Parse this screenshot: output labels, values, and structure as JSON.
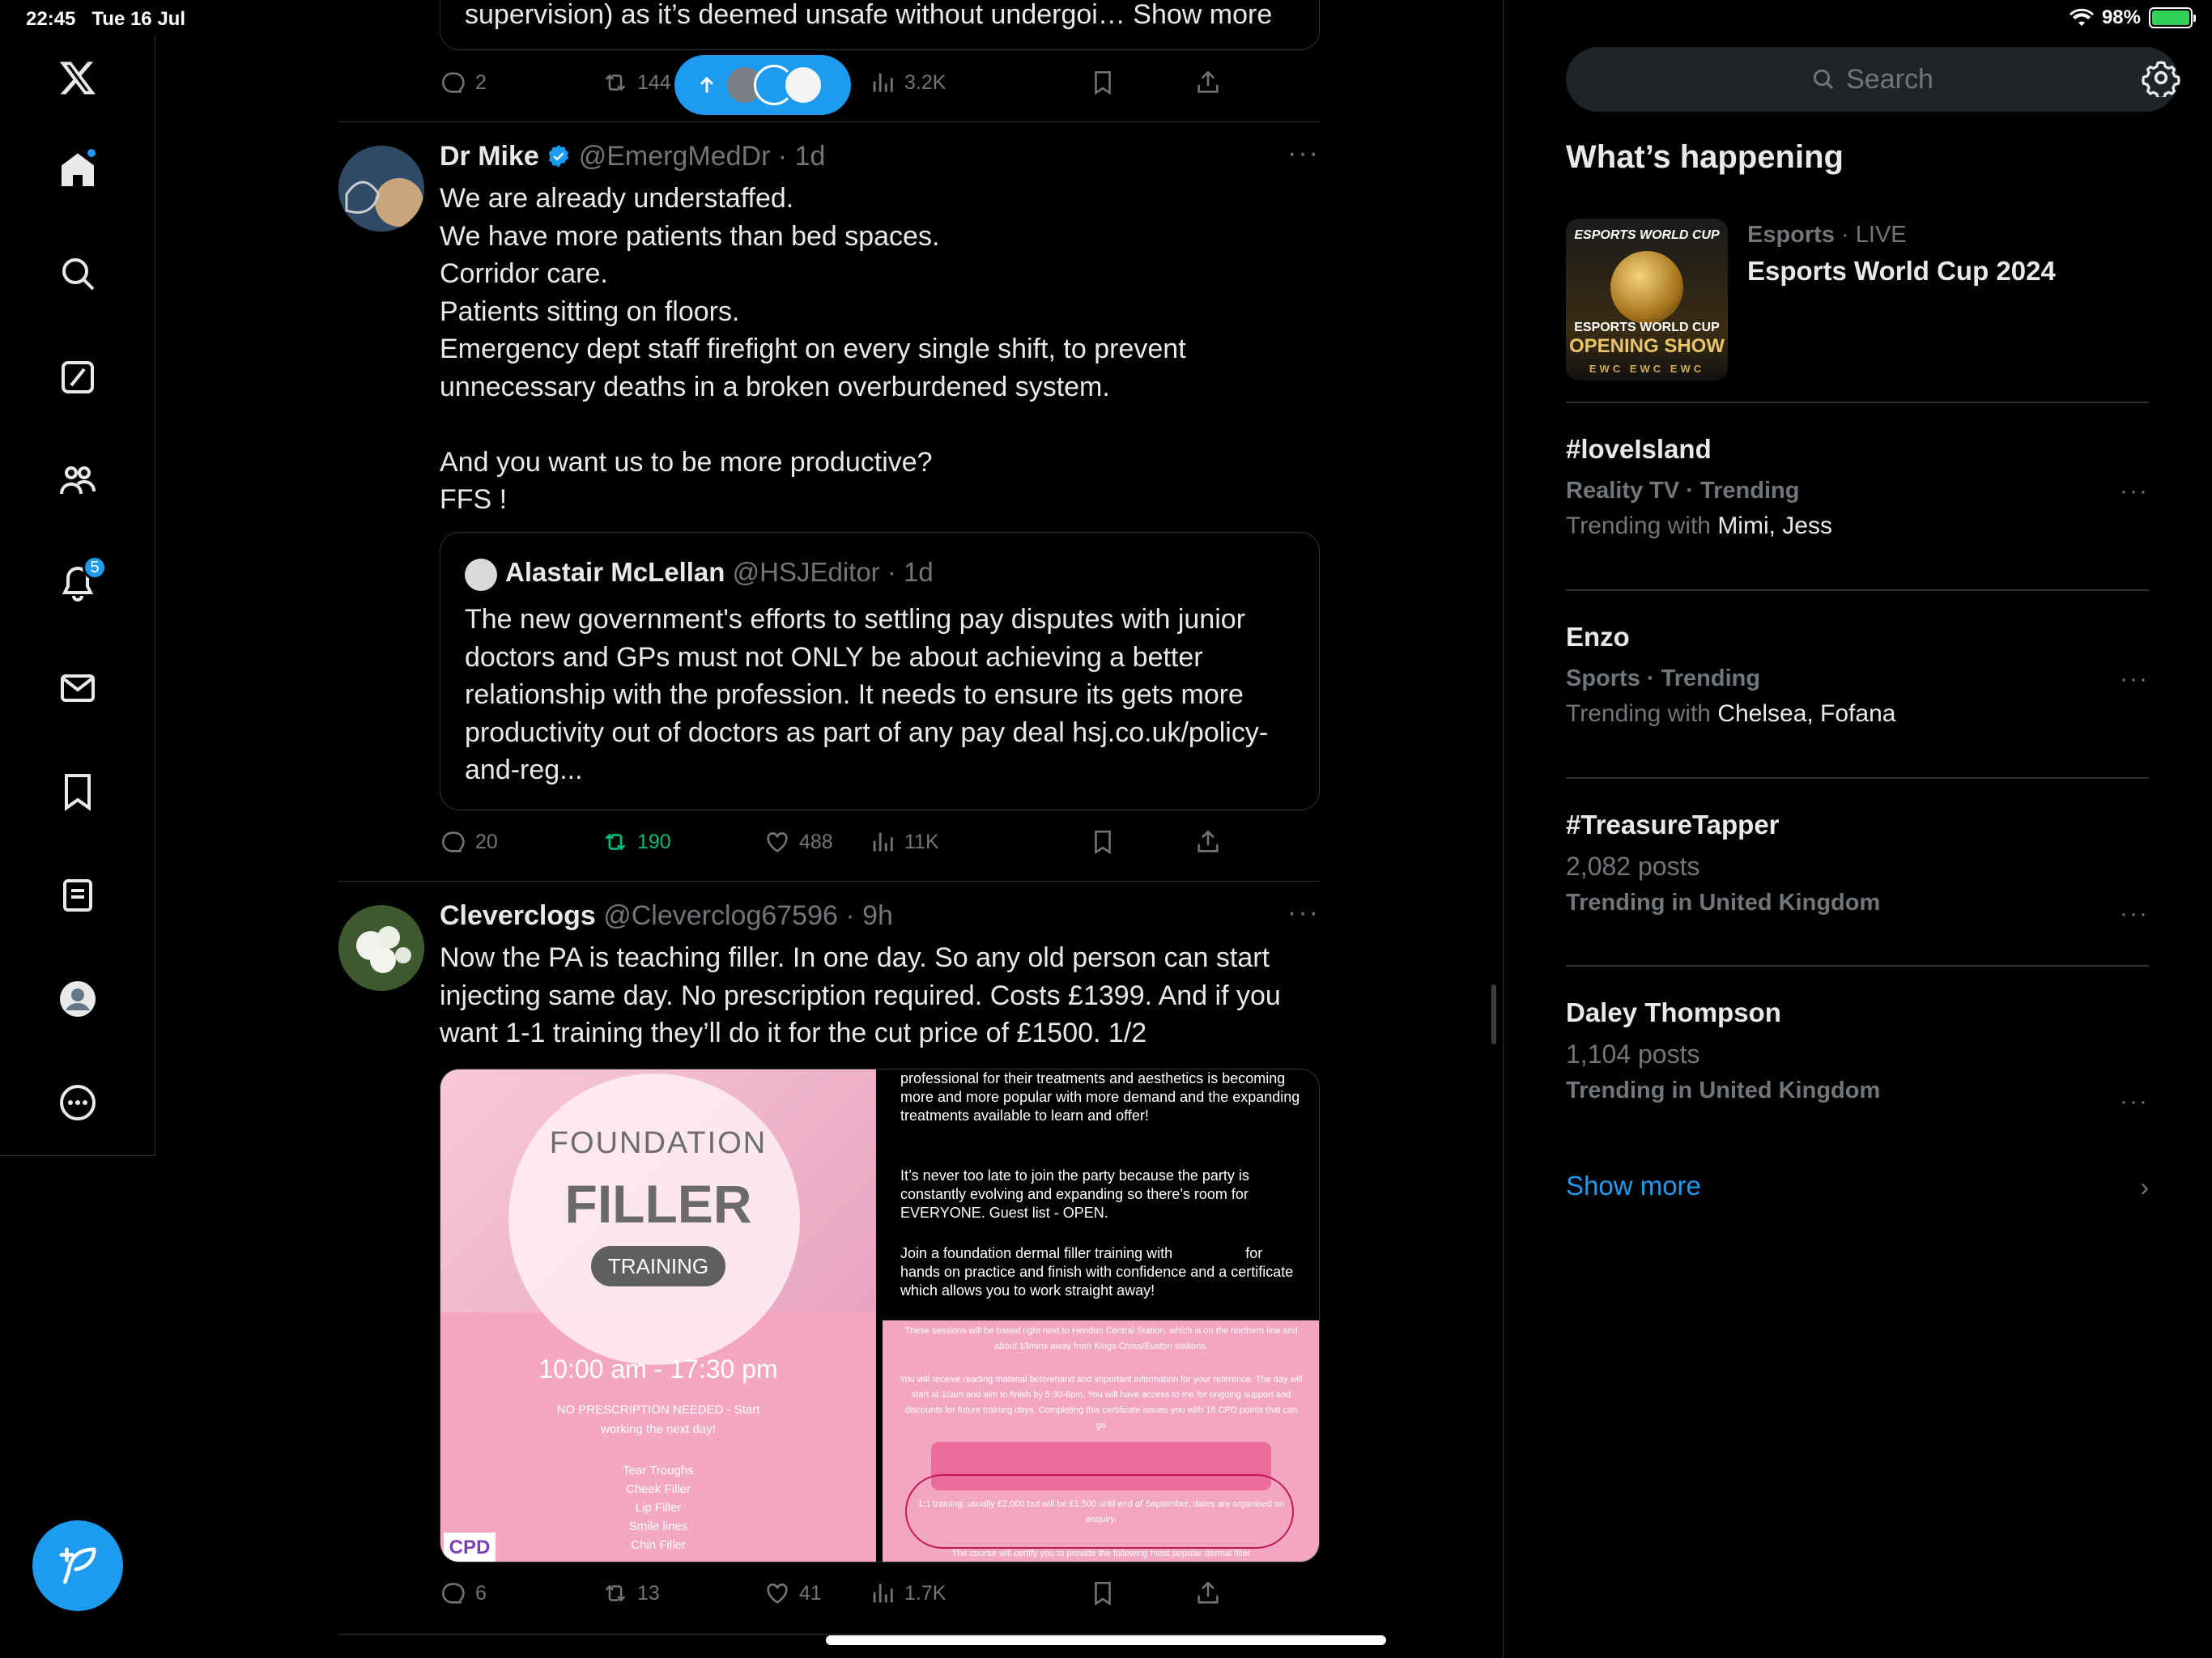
{
  "status": {
    "time": "22:45",
    "date": "Tue 16 Jul",
    "battery": "98%"
  },
  "sidebar": {
    "items": [
      {
        "name": "x-logo"
      },
      {
        "name": "home"
      },
      {
        "name": "explore"
      },
      {
        "name": "grok"
      },
      {
        "name": "communities"
      },
      {
        "name": "notifications",
        "badge": "5"
      },
      {
        "name": "messages"
      },
      {
        "name": "bookmarks"
      },
      {
        "name": "lists"
      },
      {
        "name": "profile"
      },
      {
        "name": "more"
      }
    ]
  },
  "top_tweet": {
    "truncated_text": "supervision) as it’s deemed unsafe without undergoi…",
    "show_more": "Show more",
    "replies": "2",
    "reposts": "144",
    "views": "3.2K"
  },
  "tweets": [
    {
      "author": "Dr Mike",
      "handle": "@EmergMedDr",
      "time": "· 1d",
      "verified": true,
      "text": "We are already understaffed.\nWe have more patients than bed spaces.\nCorridor care.\nPatients sitting on floors.\nEmergency dept staff firefight on every single shift, to prevent unnecessary deaths in a broken overburdened system.\n\nAnd you want us to be more productive?\nFFS !",
      "quote": {
        "author": "Alastair McLellan",
        "handle": "@HSJEditor",
        "time": "· 1d",
        "text": "The new government's efforts to settling pay disputes with junior doctors and GPs must not ONLY be about achieving a better relationship with the profession. It needs to ensure its gets more productivity out of doctors as part of any pay deal hsj.co.uk/policy-and-reg..."
      },
      "replies": "20",
      "reposts": "190",
      "likes": "488",
      "views": "11K"
    },
    {
      "author": "Cleverclogs",
      "handle": "@Cleverclog67596",
      "time": "· 9h",
      "text": "Now the PA is teaching filler. In one day. So any old person can start injecting same day. No prescription required. Costs £1399. And if you want 1-1 training they’ll do it for the cut price of £1500. 1/2",
      "media_left": {
        "line1": "FOUNDATION",
        "line2": "FILLER",
        "pill": "TRAINING",
        "time": "10:00 am - 17:30 pm",
        "note1": "NO PRESCRIPTION NEEDED - Start",
        "note2": "working the next day!",
        "list": [
          "Tear Troughs",
          "Cheek Filler",
          "Lip Filler",
          "Smile lines",
          "Chin Filler"
        ],
        "cpd": "CPD"
      },
      "media_right": {
        "p1": "professional for their treatments and aesthetics is becoming more and more popular with more demand and the expanding treatments available to learn and offer!",
        "p2": "It’s never too late to join the party because the party is constantly evolving and expanding so there’s room for EVERYONE. Guest list - OPEN.",
        "p3": "Join a foundation dermal filler training with                  for hands on practice and finish with confidence and a certificate which allows you to work straight away!",
        "pink1": "These sessions will be based right next to Hendon Central Station, which is on the northern line and about 13mins away from Kings Cross/Euston stations.",
        "pink2": "You will receive reading material beforehand and important information for your reference. The day will start at 10am and aim to finish by 5:30-6pm. You will have access to me for ongoing support and discounts for future training days. Completing this certificate issues you with 16 CPD points that can go",
        "pink3": "1:1 training: usually £2,000 but will be £1,500 until end of September, dates are organised on enquiry.",
        "pink4": "The course will certify you to provide the following most popular dermal filler"
      },
      "replies": "6",
      "reposts": "13",
      "likes": "41",
      "views": "1.7K"
    }
  ],
  "right": {
    "search_placeholder": "Search",
    "title": "What’s happening",
    "featured": {
      "category": "Esports",
      "live": "· LIVE",
      "title": "Esports World Cup 2024",
      "thumb_top": "ESPORTS WORLD CUP",
      "thumb_mid": "ESPORTS WORLD CUP",
      "thumb_bottom": "OPENING SHOW",
      "thumb_footer": "EWC EWC EWC"
    },
    "trends": [
      {
        "meta": "",
        "title": "#loveIsland",
        "sub_meta": "Reality TV · Trending",
        "with_label": "Trending with ",
        "with": "Mimi, Jess"
      },
      {
        "meta": "",
        "title": "Enzo",
        "sub_meta": "Sports · Trending",
        "with_label": "Trending with ",
        "with": "Chelsea, Fofana"
      },
      {
        "meta": "",
        "title": "#TreasureTapper",
        "sub_meta": "2,082 posts",
        "with_label": "Trending in United Kingdom",
        "with": ""
      },
      {
        "meta": "",
        "title": "Daley Thompson",
        "sub_meta": "1,104 posts",
        "with_label": "Trending in United Kingdom",
        "with": ""
      }
    ],
    "show_more": "Show more"
  },
  "colors": {
    "accent": "#1d9bf0",
    "repost_active": "#00ba7c",
    "muted": "#71767b",
    "pink": "#f2a6c0"
  }
}
